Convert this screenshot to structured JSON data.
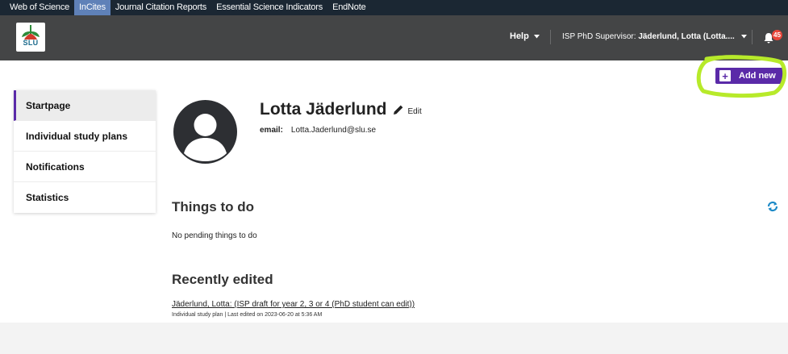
{
  "topbar": {
    "links": [
      "Web of Science",
      "InCites",
      "Journal Citation Reports",
      "Essential Science Indicators",
      "EndNote"
    ],
    "active_index": 1
  },
  "header": {
    "logo_text": "SLU",
    "help_label": "Help",
    "user_prefix": "ISP PhD Supervisor:",
    "user_name": "Jäderlund, Lotta (Lotta....",
    "notification_count": "45"
  },
  "actions": {
    "add_new_label": "Add new"
  },
  "sidebar": {
    "items": [
      {
        "label": "Startpage"
      },
      {
        "label": "Individual study plans"
      },
      {
        "label": "Notifications"
      },
      {
        "label": "Statistics"
      }
    ],
    "active_index": 0
  },
  "profile": {
    "name": "Lotta Jäderlund",
    "edit_label": "Edit",
    "email_label": "email:",
    "email_value": "Lotta.Jaderlund@slu.se"
  },
  "things_to_do": {
    "title": "Things to do",
    "empty_text": "No pending things to do"
  },
  "recently_edited": {
    "title": "Recently edited",
    "items": [
      {
        "link": "Jäderlund, Lotta: (ISP draft for year 2, 3 or 4 (PhD student can edit))",
        "meta": "Individual study plan | Last edited on 2023-06-20 at 5:36 AM"
      }
    ]
  },
  "colors": {
    "accent": "#5a2aa8",
    "topbar": "#1b2733",
    "appbar": "#444546",
    "highlight": "#b7ea2a",
    "badge": "#e8463a"
  }
}
